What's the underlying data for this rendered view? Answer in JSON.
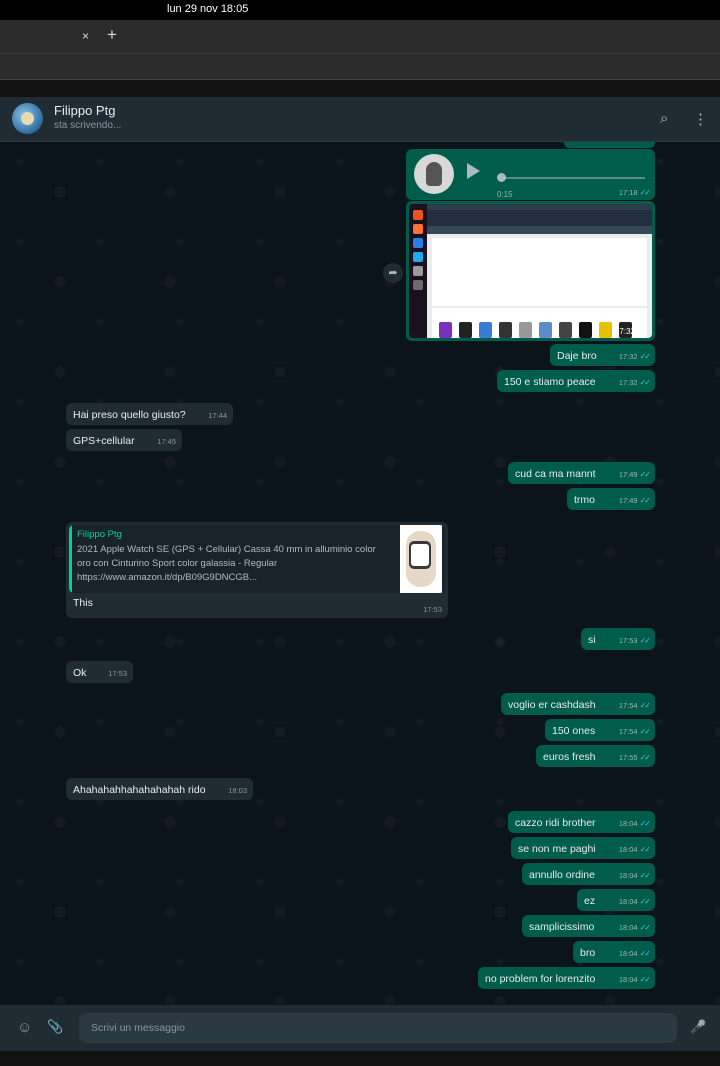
{
  "system": {
    "clock": "lun 29 nov  18:05"
  },
  "browser": {
    "tab_close": "×",
    "tab_new": "+"
  },
  "header": {
    "name": "Filippo Ptg",
    "status": "sta scrivendo...",
    "search_icon": "⌕",
    "menu_icon": "⋮"
  },
  "voice": {
    "duration": "0:15",
    "time": "17:18"
  },
  "photo": {
    "time": "17:32"
  },
  "messages": [
    {
      "dir": "out",
      "text": "Daje bro",
      "time": "17:32"
    },
    {
      "dir": "out",
      "text": "150 e stiamo peace",
      "time": "17:32"
    },
    {
      "dir": "in",
      "text": "Hai preso quello giusto?",
      "time": "17:44"
    },
    {
      "dir": "in",
      "text": "GPS+cellular",
      "time": "17:45"
    },
    {
      "dir": "out",
      "text": "cud ca ma mannt",
      "time": "17:49"
    },
    {
      "dir": "out",
      "text": "trmo",
      "time": "17:49"
    },
    {
      "dir": "out",
      "text": "si",
      "time": "17:53"
    },
    {
      "dir": "in",
      "text": "Ok",
      "time": "17:53"
    },
    {
      "dir": "out",
      "text": "voglio er cashdash",
      "time": "17:54"
    },
    {
      "dir": "out",
      "text": "150 ones",
      "time": "17:54"
    },
    {
      "dir": "out",
      "text": "euros fresh",
      "time": "17:55"
    },
    {
      "dir": "in",
      "text": "Ahahahahhahahahahah rido",
      "time": "18:03"
    },
    {
      "dir": "out",
      "text": "cazzo ridi brother",
      "time": "18:04"
    },
    {
      "dir": "out",
      "text": "se non me paghi",
      "time": "18:04"
    },
    {
      "dir": "out",
      "text": "annullo ordine",
      "time": "18:04"
    },
    {
      "dir": "out",
      "text": "ez",
      "time": "18:04"
    },
    {
      "dir": "out",
      "text": "samplicissimo",
      "time": "18:04"
    },
    {
      "dir": "out",
      "text": "bro",
      "time": "18:04"
    },
    {
      "dir": "out",
      "text": "no problem for lorenzito",
      "time": "18:04"
    }
  ],
  "quote": {
    "author": "Filippo Ptg",
    "text": "2021 Apple Watch SE (GPS + Cellular) Cassa 40 mm in alluminio color oro con Cinturino Sport color galassia - Regular https://www.amazon.it/dp/B09G9DNCGB...",
    "reply": "This",
    "time": "17:53"
  },
  "composer": {
    "placeholder": "Scrivi un messaggio",
    "emoji_icon": "☺",
    "attach_icon": "📎",
    "mic_icon": "🎤"
  },
  "colors": {
    "outgoing": "#005c4b",
    "incoming": "#202c33",
    "accent": "#06cf9c",
    "tick": "#53bdeb"
  }
}
